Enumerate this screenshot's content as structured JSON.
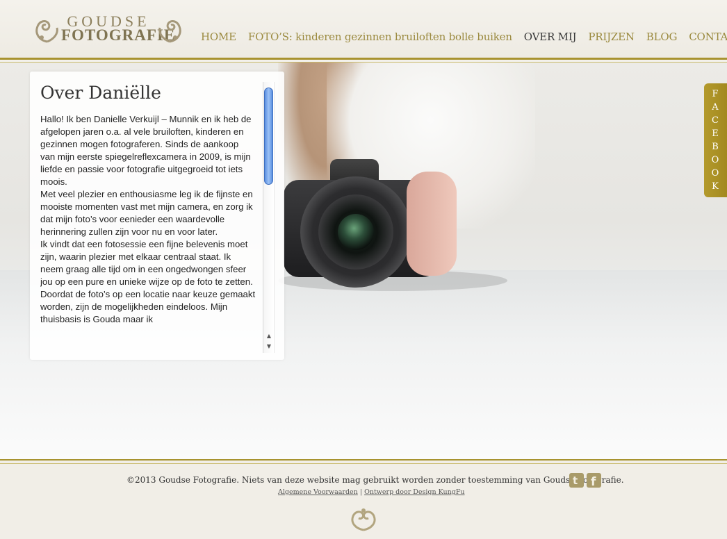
{
  "brand": {
    "line1": "GOUDSE",
    "line2": "FOTOGRAFIE",
    "accent_color": "#a8932f"
  },
  "nav": [
    {
      "label": "HOME",
      "active": false
    },
    {
      "label": "FOTO’S: kinderen gezinnen bruiloften bolle buiken",
      "active": false
    },
    {
      "label": "OVER MIJ",
      "active": true
    },
    {
      "label": "PRIJZEN",
      "active": false
    },
    {
      "label": "BLOG",
      "active": false
    },
    {
      "label": "CONTACT",
      "active": false
    }
  ],
  "content": {
    "title": "Over Daniëlle",
    "paragraphs": [
      "Hallo! Ik ben Danielle Verkuijl – Munnik en ik heb de afgelopen jaren o.a. al vele bruiloften, kinderen en gezinnen mogen fotograferen. Sinds de aankoop van mijn eerste spiegelreflexcamera in 2009, is mijn liefde en passie voor fotografie uitgegroeid tot iets moois.",
      "Met veel plezier en enthousiasme leg ik de fijnste en mooiste momenten vast met mijn camera, en zorg ik dat mijn foto’s voor eenieder een waardevolle herinnering zullen zijn voor nu en voor later.",
      "Ik vindt dat een fotosessie een fijne belevenis moet zijn, waarin plezier met elkaar centraal staat. Ik neem graag alle tijd om in een ongedwongen sfeer jou op een pure en unieke wijze op de foto te zetten.",
      "Doordat de foto’s op een locatie naar keuze gemaakt worden, zijn de mogelijkheden eindeloos. Mijn thuisbasis is Gouda maar ik"
    ]
  },
  "facebook_tab": {
    "letters": [
      "F",
      "A",
      "C",
      "E",
      "B",
      "O",
      "O",
      "K"
    ]
  },
  "footer": {
    "copyright": "©2013 Goudse Fotografie. Niets van deze website mag gebruikt worden zonder toestemming van Goudse Fotografie.",
    "link_terms": "Algemene Voorwaarden",
    "separator": "|",
    "link_design": "Ontwerp door Design KungFu",
    "social": [
      "twitter-icon",
      "facebook-icon"
    ]
  }
}
